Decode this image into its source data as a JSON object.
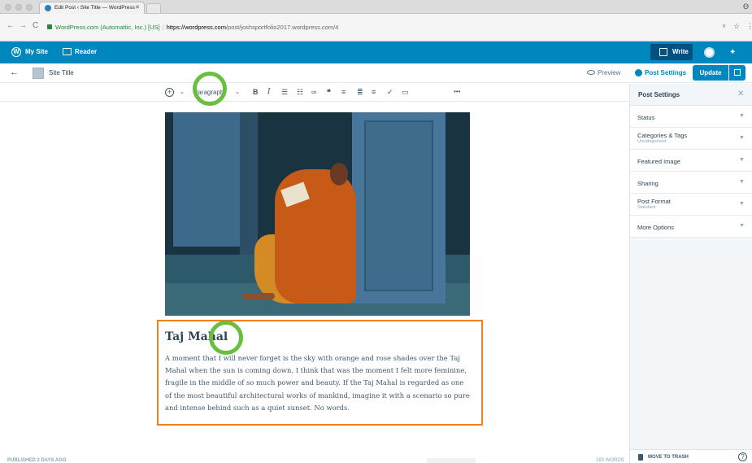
{
  "browser": {
    "tab_title": "Edit Post ‹ Site Title — WordPress",
    "url_secure_label": "WordPress.com (Automattic, Inc.) [US]",
    "url_scheme_host": "https://wordpress.com",
    "url_path": "/post/joshsportfolio2017.wordpress.com/4"
  },
  "masterbar": {
    "my_site": "My Site",
    "reader": "Reader",
    "write": "Write"
  },
  "editor_header": {
    "site_title": "Site Title",
    "preview": "Preview",
    "post_settings_tab": "Post Settings",
    "update": "Update"
  },
  "toolbar": {
    "paragraph": "Paragraph",
    "bold": "B",
    "italic": "I",
    "more": "•••"
  },
  "post": {
    "title": "Taj Mahal",
    "body": "A moment that I will never forget is the sky with orange and rose shades over the Taj Mahal when the sun is coming down. I think that was the moment I felt more feminine, fragile in the middle of so much power and beauty. If the Taj Mahal is regarded as one of the most beautiful architectural works of mankind, imagine it with a scenario so pure and intense behind such as a quiet sunset. No words."
  },
  "status_bar": {
    "published": "PUBLISHED 2 DAYS AGO",
    "words": "183 WORDS"
  },
  "sidebar": {
    "header": "Post Settings",
    "items": [
      {
        "label": "Status",
        "sub": ""
      },
      {
        "label": "Categories & Tags",
        "sub": "Uncategorized"
      },
      {
        "label": "Featured Image",
        "sub": ""
      },
      {
        "label": "Sharing",
        "sub": ""
      },
      {
        "label": "Post Format",
        "sub": "Standard"
      },
      {
        "label": "More Options",
        "sub": ""
      }
    ],
    "trash": "MOVE TO TRASH"
  },
  "colors": {
    "brand_blue": "#0087be",
    "highlight_orange": "#f0821e",
    "annotation_green": "#6abf3f"
  }
}
